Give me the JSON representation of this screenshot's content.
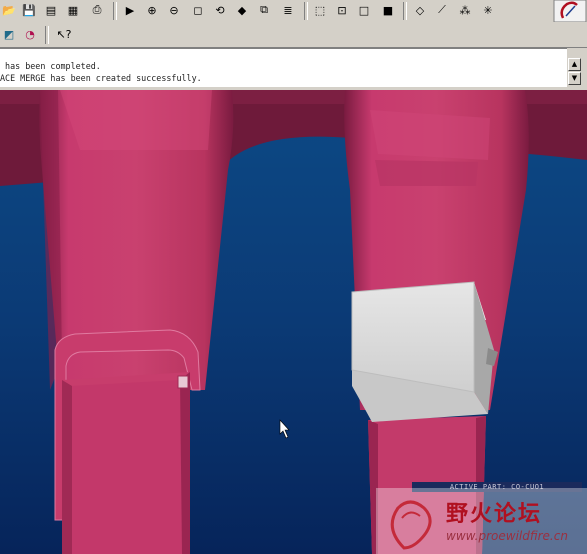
{
  "toolbar_top": {
    "buttons": [
      {
        "name": "open-file-icon",
        "glyph": "📂"
      },
      {
        "name": "save-icon",
        "glyph": "💾"
      },
      {
        "name": "save-copy-icon",
        "glyph": "▤"
      },
      {
        "name": "multi-window-icon",
        "glyph": "▦"
      },
      {
        "name": "print-icon",
        "glyph": "⎙"
      },
      {
        "name": "repaint-icon",
        "glyph": "▶"
      },
      {
        "name": "zoom-in-icon",
        "glyph": "⊕"
      },
      {
        "name": "zoom-out-icon",
        "glyph": "⊖"
      },
      {
        "name": "refit-icon",
        "glyph": "◻"
      },
      {
        "name": "orient-icon",
        "glyph": "⟲"
      },
      {
        "name": "saved-view-icon",
        "glyph": "◆"
      },
      {
        "name": "view-manager-icon",
        "glyph": "⧉"
      },
      {
        "name": "layer-icon",
        "glyph": "≣"
      },
      {
        "name": "wireframe-icon",
        "glyph": "⬚"
      },
      {
        "name": "hidden-line-icon",
        "glyph": "⊡"
      },
      {
        "name": "no-hidden-icon",
        "glyph": "□"
      },
      {
        "name": "shading-icon",
        "glyph": "■"
      },
      {
        "name": "datum-plane-icon",
        "glyph": "◇"
      },
      {
        "name": "datum-axis-icon",
        "glyph": "⟋"
      },
      {
        "name": "datum-point-icon",
        "glyph": "⁂"
      },
      {
        "name": "coordinate-system-icon",
        "glyph": "✳"
      }
    ]
  },
  "toolbar_second": {
    "buttons": [
      {
        "name": "select-icon",
        "glyph": "◩"
      },
      {
        "name": "spin-center-icon",
        "glyph": "◔"
      },
      {
        "name": "context-help-icon",
        "glyph": "↖?"
      }
    ]
  },
  "messages": {
    "line1": " has been completed.",
    "line2": "ACE MERGE has been created successfully."
  },
  "status": {
    "active_part": "ACTIVE PART: CO-CUO1"
  },
  "watermark": {
    "title": "野火论坛",
    "url": "www.proewildfire.cn"
  },
  "colors": {
    "background_blue": "#0a3a78",
    "part_pink": "#c03a6a",
    "part_dark": "#8a1f45",
    "block_grey": "#d6d6d6"
  }
}
